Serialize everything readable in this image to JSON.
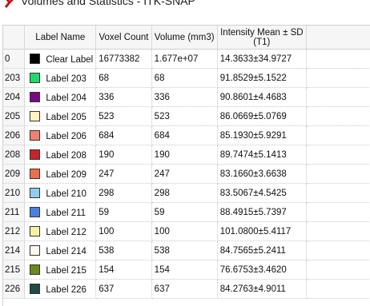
{
  "window": {
    "title": "Volumes and Statistics - ITK-SNAP"
  },
  "table": {
    "headers": {
      "label_name": "Label Name",
      "voxel_count": "Voxel Count",
      "volume": "Volume (mm3)",
      "intensity": "Intensity Mean ± SD (T1)"
    },
    "rows": [
      {
        "id": "0",
        "name": "Clear Label",
        "color": "#000000",
        "voxels": "16773382",
        "volume": "1.677e+07",
        "intensity": "14.3633±34.9727"
      },
      {
        "id": "203",
        "name": "Label 203",
        "color": "#22d96a",
        "voxels": "68",
        "volume": "68",
        "intensity": "91.8529±5.1522"
      },
      {
        "id": "204",
        "name": "Label 204",
        "color": "#7a0a85",
        "voxels": "336",
        "volume": "336",
        "intensity": "90.8601±4.4683"
      },
      {
        "id": "205",
        "name": "Label 205",
        "color": "#fff3c2",
        "voxels": "523",
        "volume": "523",
        "intensity": "86.0669±5.0769"
      },
      {
        "id": "206",
        "name": "Label 206",
        "color": "#f08070",
        "voxels": "684",
        "volume": "684",
        "intensity": "85.1930±5.9291"
      },
      {
        "id": "208",
        "name": "Label 208",
        "color": "#c4242a",
        "voxels": "190",
        "volume": "190",
        "intensity": "89.7474±5.1413"
      },
      {
        "id": "209",
        "name": "Label 209",
        "color": "#f06e4c",
        "voxels": "247",
        "volume": "247",
        "intensity": "83.1660±3.6638"
      },
      {
        "id": "210",
        "name": "Label 210",
        "color": "#8ecff0",
        "voxels": "298",
        "volume": "298",
        "intensity": "83.5067±4.5425"
      },
      {
        "id": "211",
        "name": "Label 211",
        "color": "#4a80e0",
        "voxels": "59",
        "volume": "59",
        "intensity": "88.4915±5.7397"
      },
      {
        "id": "212",
        "name": "Label 212",
        "color": "#f8f0a0",
        "voxels": "100",
        "volume": "100",
        "intensity": "101.0800±5.4117"
      },
      {
        "id": "214",
        "name": "Label 214",
        "color": "#fff8ee",
        "voxels": "538",
        "volume": "538",
        "intensity": "84.7565±5.2411"
      },
      {
        "id": "215",
        "name": "Label 215",
        "color": "#6a8a1e",
        "voxels": "154",
        "volume": "154",
        "intensity": "76.6753±3.4620"
      },
      {
        "id": "226",
        "name": "Label 226",
        "color": "#1e4a4a",
        "voxels": "637",
        "volume": "637",
        "intensity": "84.2763±4.9011"
      }
    ]
  }
}
